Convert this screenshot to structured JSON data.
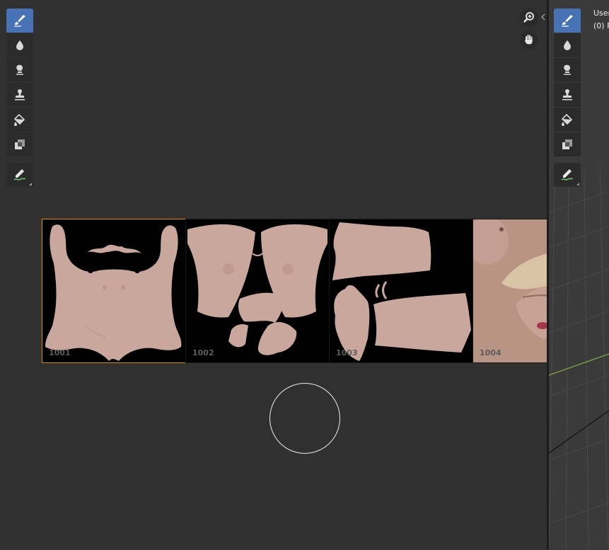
{
  "viewport": {
    "title_line": "User",
    "object_line": "(0) F"
  },
  "udim_tiles": [
    {
      "label": "1001",
      "selected": true
    },
    {
      "label": "1002",
      "selected": false
    },
    {
      "label": "1003",
      "selected": false
    },
    {
      "label": "1004",
      "selected": false
    }
  ],
  "image_toolbar": [
    {
      "name": "draw-tool",
      "icon": "brush-icon",
      "active": true
    },
    {
      "name": "soften-tool",
      "icon": "drop-icon",
      "active": false
    },
    {
      "name": "smear-tool",
      "icon": "smear-icon",
      "active": false
    },
    {
      "name": "clone-tool",
      "icon": "stamp-icon",
      "active": false
    },
    {
      "name": "fill-tool",
      "icon": "bucket-icon",
      "active": false
    },
    {
      "name": "mask-tool",
      "icon": "mask-icon",
      "active": false
    },
    {
      "name": "annotate-tool",
      "icon": "annotate-icon",
      "active": false
    }
  ],
  "colors": {
    "active_tool": "#4772b3",
    "selected_tile_outline": "#e08a1e",
    "editor_background": "#303030"
  }
}
